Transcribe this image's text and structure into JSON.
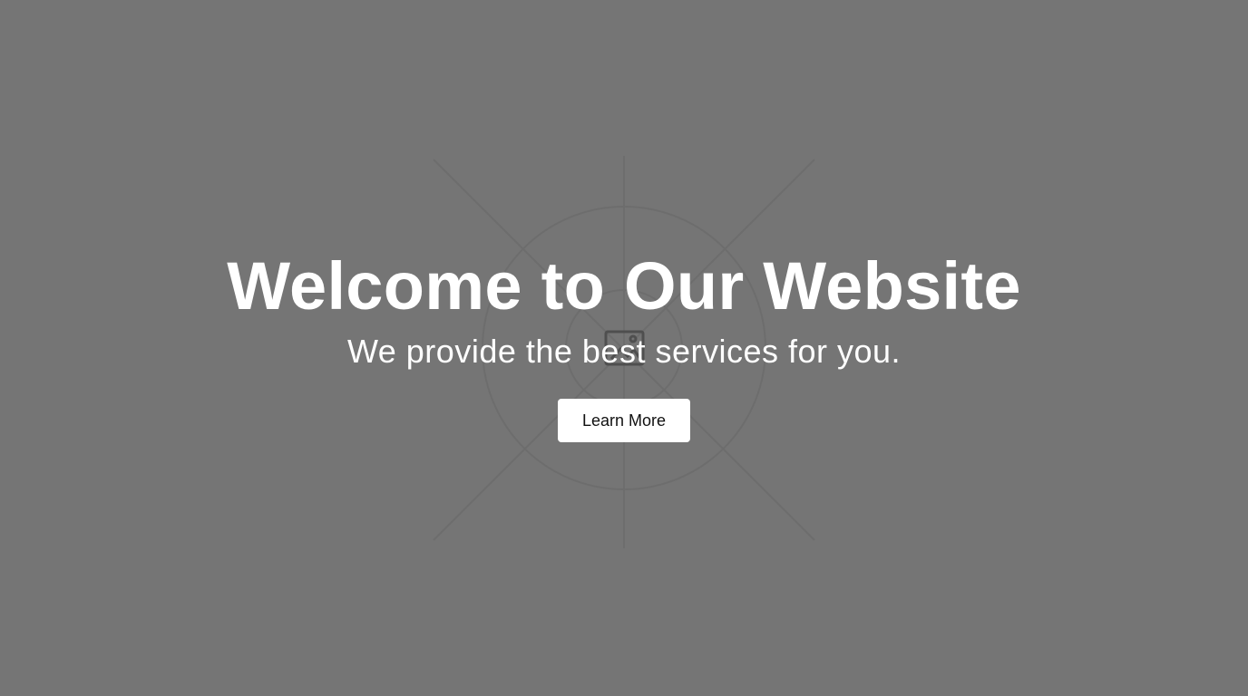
{
  "hero": {
    "title": "Welcome to Our Website",
    "subtitle": "We provide the best services for you.",
    "button_label": "Learn More"
  },
  "colors": {
    "background": "#757575",
    "text": "#ffffff",
    "button_background": "#ffffff",
    "button_text": "#111111"
  },
  "icons": {
    "background_placeholder": "image-placeholder-icon"
  }
}
